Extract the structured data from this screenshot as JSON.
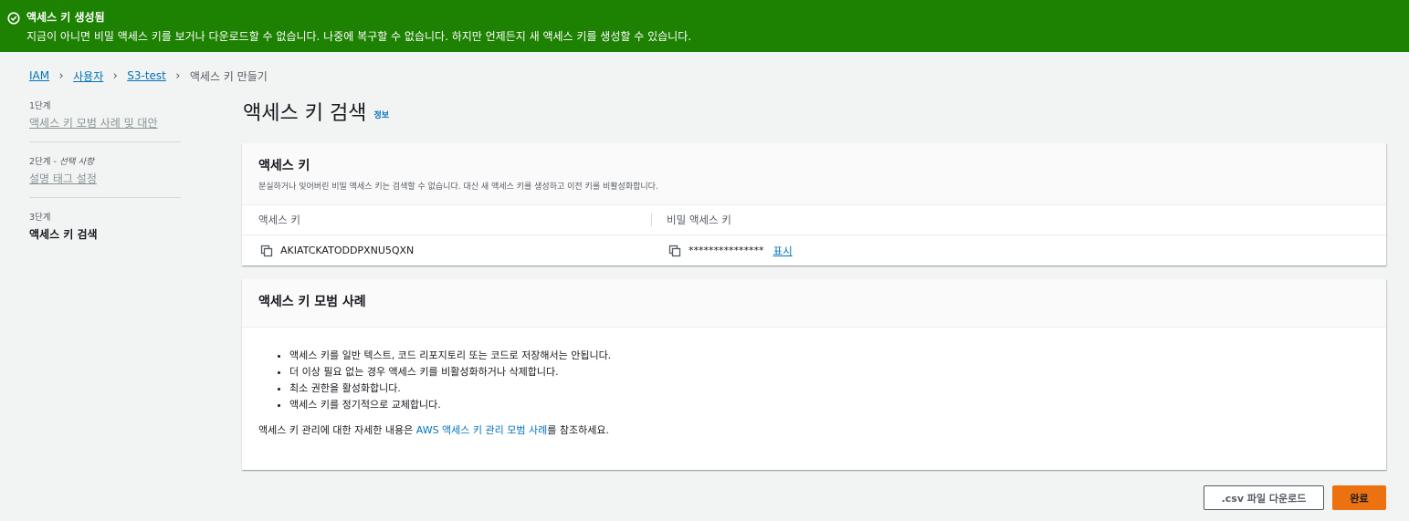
{
  "flash": {
    "title": "액세스 키 생성됨",
    "message": "지금이 아니면 비밀 액세스 키를 보거나 다운로드할 수 없습니다. 나중에 복구할 수 없습니다. 하지만 언제든지 새 액세스 키를 생성할 수 있습니다.",
    "color": "#1d8102",
    "icon": "check-circle-icon"
  },
  "breadcrumb": {
    "items": [
      "IAM",
      "사용자",
      "S3-test"
    ],
    "current": "액세스 키 만들기"
  },
  "steps": [
    {
      "num": "1단계",
      "optional": "",
      "title": "액세스 키 모범 사례 및 대안"
    },
    {
      "num": "2단계 - ",
      "optional": "선택 사항",
      "title": "설명 태그 설정"
    },
    {
      "num": "3단계",
      "optional": "",
      "title": "액세스 키 검색"
    }
  ],
  "page": {
    "title": "액세스 키 검색",
    "info": "정보"
  },
  "access_key_card": {
    "title": "액세스 키",
    "description": "분실하거나 잊어버린 비밀 액세스 키는 검색할 수 없습니다. 대신 새 액세스 키를 생성하고 이전 키를 비활성화합니다.",
    "col_access_key": "액세스 키",
    "col_secret_key": "비밀 액세스 키",
    "access_key_value": "AKIATCKATODDPXNU5QXN",
    "secret_key_masked": "***************",
    "show_label": "표시"
  },
  "best_practices_card": {
    "title": "액세스 키 모범 사례",
    "items": [
      "액세스 키를 일반 텍스트, 코드 리포지토리 또는 코드로 저장해서는 안됩니다.",
      "더 이상 필요 없는 경우 액세스 키를 비활성화하거나 삭제합니다.",
      "최소 권한을 활성화합니다.",
      "액세스 키를 정기적으로 교체합니다."
    ],
    "ref_prefix": "액세스 키 관리에 대한 자세한 내용은 ",
    "ref_link": "AWS 액세스 키 관리 모범 사례",
    "ref_suffix": "를 참조하세요."
  },
  "footer": {
    "download_label": ".csv 파일 다운로드",
    "done_label": "완료",
    "primary_color": "#ec7211"
  }
}
